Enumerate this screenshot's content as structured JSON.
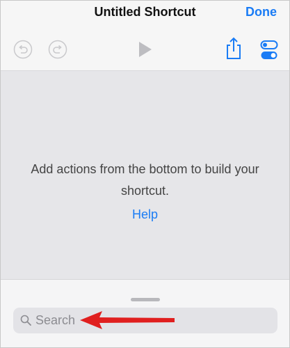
{
  "header": {
    "title": "Untitled Shortcut",
    "done_label": "Done"
  },
  "toolbar": {
    "icons": [
      "undo-icon",
      "redo-icon",
      "play-icon",
      "share-icon",
      "settings-toggle-icon"
    ]
  },
  "empty_state": {
    "message": "Add actions from the bottom to build your shortcut.",
    "help_label": "Help"
  },
  "search": {
    "placeholder": "Search"
  },
  "colors": {
    "accent": "#1a7cf5",
    "annotation_arrow": "#e01f1f"
  }
}
